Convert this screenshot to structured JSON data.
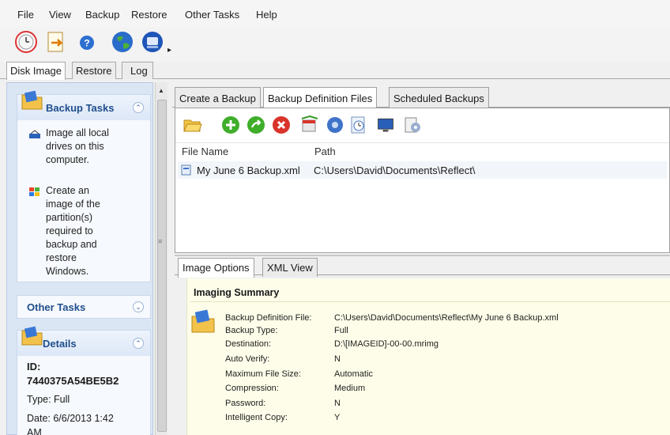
{
  "menu": [
    "File",
    "View",
    "Backup",
    "Restore",
    "Other Tasks",
    "Help"
  ],
  "view_tabs": [
    "Disk Image",
    "Restore",
    "Log"
  ],
  "sidebar": {
    "backup_tasks_title": "Backup Tasks",
    "task1": [
      "Image all local",
      "drives on this",
      "computer."
    ],
    "task2": [
      "Create an",
      "image of the",
      "partition(s)",
      "required to",
      "backup and",
      "restore",
      "Windows."
    ],
    "other_tasks_title": "Other Tasks",
    "details_title": "Details",
    "details_id_label": "ID:",
    "details_id": "7440375A54BE5B2",
    "details_type": "Type: Full",
    "details_date": "Date:  6/6/2013 1:42",
    "details_date_cont": "AM"
  },
  "main": {
    "top_tabs": [
      "Create a Backup",
      "Backup Definition Files",
      "Scheduled Backups"
    ],
    "columns": {
      "file_name": "File Name",
      "path": "Path"
    },
    "files": [
      {
        "name": "My June 6 Backup.xml",
        "path": "C:\\Users\\David\\Documents\\Reflect\\"
      }
    ],
    "bottom_tabs": [
      "Image Options",
      "XML View"
    ],
    "summary_title": "Imaging Summary",
    "summary": [
      {
        "label": "Backup Definition File:",
        "value": "C:\\Users\\David\\Documents\\Reflect\\My June 6 Backup.xml"
      },
      {
        "label": "Backup Type:",
        "value": "Full"
      },
      {
        "label": "Destination:",
        "value": "D:\\[IMAGEID]-00-00.mrimg"
      },
      {
        "label": "Auto Verify:",
        "value": "N"
      },
      {
        "label": "Maximum File Size:",
        "value": "Automatic"
      },
      {
        "label": "Compression:",
        "value": "Medium"
      },
      {
        "label": "Password:",
        "value": "N"
      },
      {
        "label": "Intelligent Copy:",
        "value": "Y"
      }
    ]
  },
  "colors": {
    "sidebar_bg": "#dbe6f5",
    "panel_title": "#1f4e8c",
    "summary_bg": "#fdfde9",
    "green_button": "#3fae2a",
    "red_button": "#d9342b"
  },
  "icons": {
    "toolbar": [
      "backup-clock-icon",
      "restore-browse-icon",
      "help-icon",
      "globe-icon",
      "disk-icon"
    ],
    "definition_toolbar": [
      "open-folder-icon",
      "add-icon",
      "run-icon",
      "delete-icon",
      "schedule-icon",
      "settings-gear-icon",
      "clock-icon",
      "monitor-icon",
      "options-icon"
    ]
  }
}
